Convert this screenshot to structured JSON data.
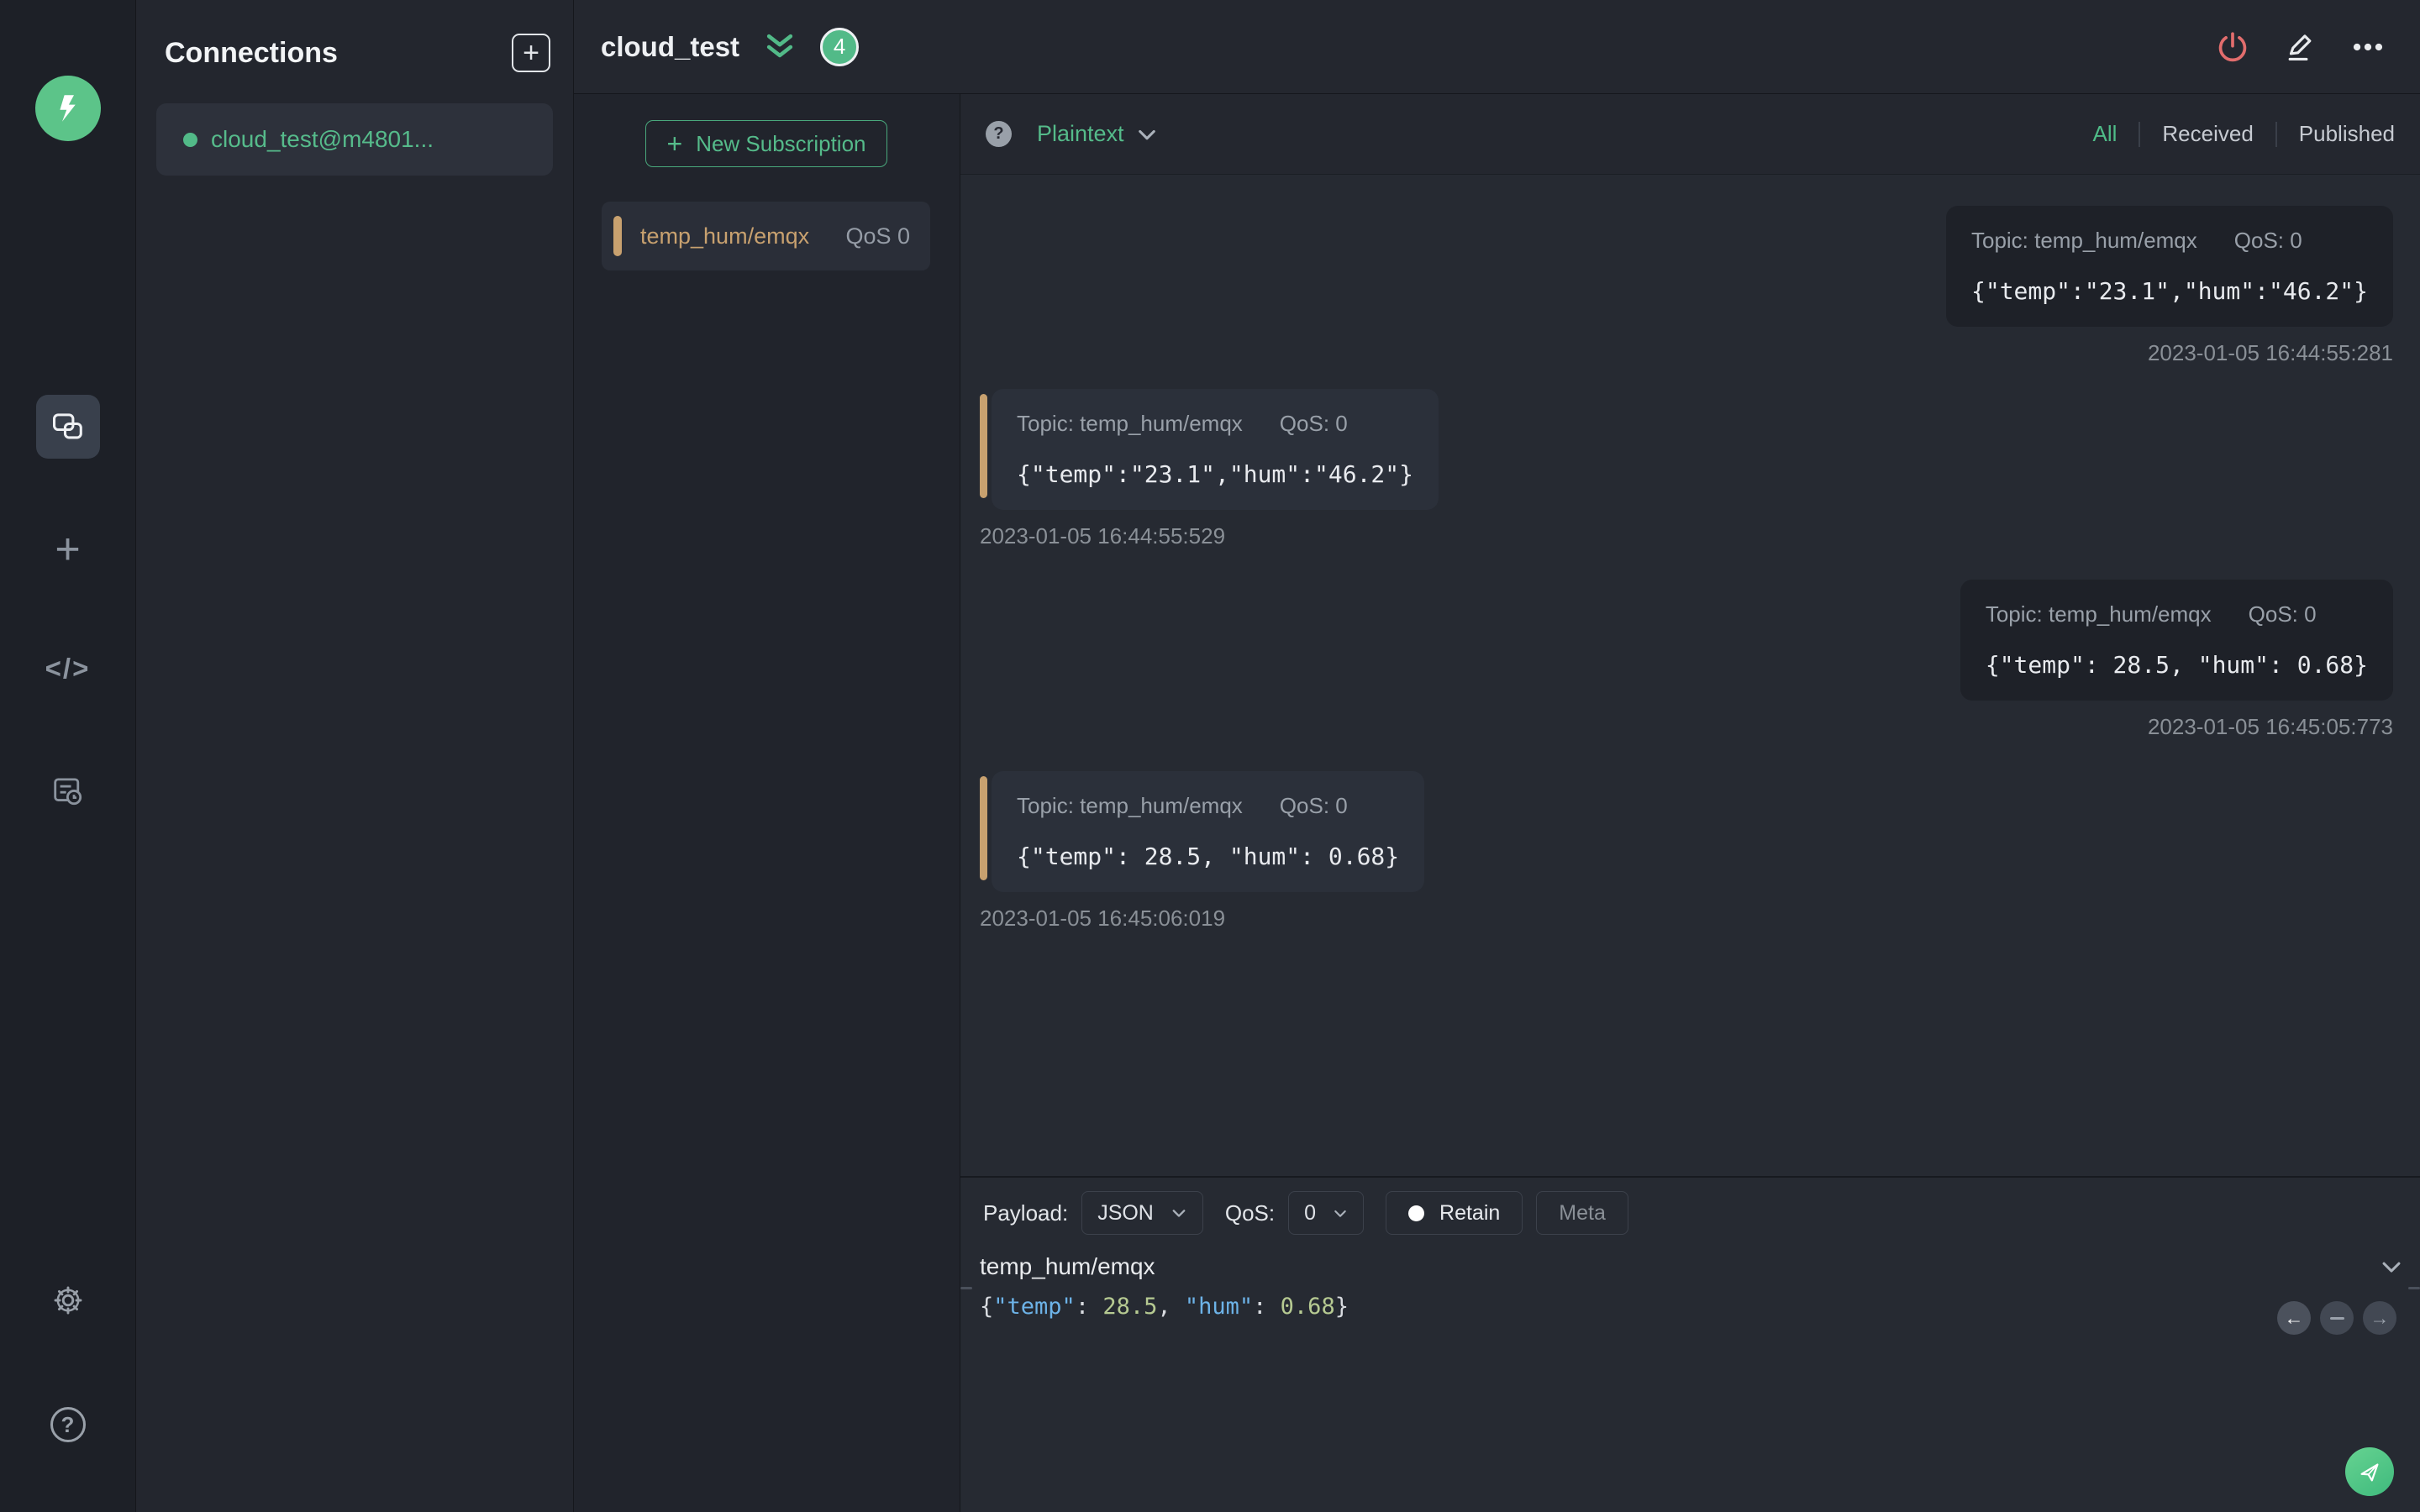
{
  "colors": {
    "accent_green": "#52ba88",
    "accent_tan": "#c8a16f",
    "danger_red": "#e26d6d",
    "panel_bg": "#23262e",
    "bubble_received": "#2b303a",
    "bubble_published": "#1e2128"
  },
  "sidebar": {
    "icons": [
      "mqttx-logo",
      "connections-icon",
      "new-connection-plus-icon",
      "script-icon",
      "log-icon",
      "settings-gear-icon",
      "help-question-icon"
    ],
    "code_icon_text": "</>"
  },
  "connections_panel": {
    "title": "Connections",
    "items": [
      {
        "label": "cloud_test@m4801..."
      }
    ]
  },
  "topbar": {
    "connection_name": "cloud_test",
    "badge_count": "4"
  },
  "subscriptions": {
    "new_button_label": "New Subscription",
    "new_button_plus": "+",
    "items": [
      {
        "topic": "temp_hum/emqx",
        "qos": "QoS 0"
      }
    ]
  },
  "msg_toolbar": {
    "help_badge": "?",
    "format_selected": "Plaintext",
    "filters": {
      "all": "All",
      "received": "Received",
      "published": "Published"
    }
  },
  "messages": [
    {
      "direction": "published",
      "topic": "Topic: temp_hum/emqx",
      "qos": "QoS: 0",
      "payload": "{\"temp\":\"23.1\",\"hum\":\"46.2\"}",
      "timestamp": "2023-01-05 16:44:55:281"
    },
    {
      "direction": "received",
      "topic": "Topic: temp_hum/emqx",
      "qos": "QoS: 0",
      "payload": "{\"temp\":\"23.1\",\"hum\":\"46.2\"}",
      "timestamp": "2023-01-05 16:44:55:529"
    },
    {
      "direction": "published",
      "topic": "Topic: temp_hum/emqx",
      "qos": "QoS: 0",
      "payload": "{\"temp\": 28.5, \"hum\": 0.68}",
      "timestamp": "2023-01-05 16:45:05:773"
    },
    {
      "direction": "received",
      "topic": "Topic: temp_hum/emqx",
      "qos": "QoS: 0",
      "payload": "{\"temp\": 28.5, \"hum\": 0.68}",
      "timestamp": "2023-01-05 16:45:06:019"
    }
  ],
  "publish_bar": {
    "payload_label": "Payload:",
    "payload_type": "JSON",
    "qos_label": "QoS:",
    "qos_value": "0",
    "retain_label": "Retain",
    "meta_label": "Meta"
  },
  "editor": {
    "topic": "temp_hum/emqx",
    "payload_tokens": {
      "lb": "{",
      "k1": "\"temp\"",
      "c1": ": ",
      "n1": "28.5",
      "cm": ", ",
      "k2": "\"hum\"",
      "c2": ": ",
      "n2": "0.68",
      "rb": "}"
    }
  }
}
